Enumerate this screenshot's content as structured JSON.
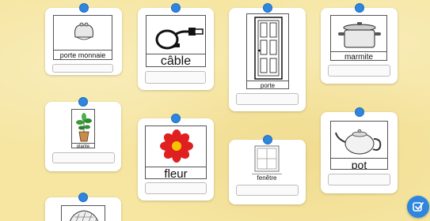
{
  "cards": [
    {
      "id": "porte-monnaie",
      "word": "porte monnaie",
      "icon": "purse-icon"
    },
    {
      "id": "cable",
      "word": "câble",
      "icon": "cable-icon"
    },
    {
      "id": "porte",
      "word": "porte",
      "icon": "door-icon"
    },
    {
      "id": "marmite",
      "word": "marmite",
      "icon": "pot-icon"
    },
    {
      "id": "plante",
      "word": "plante",
      "icon": "plant-icon"
    },
    {
      "id": "fleur",
      "word": "fleur",
      "icon": "flower-icon"
    },
    {
      "id": "fenetre",
      "word": "fenêtre",
      "icon": "window-icon"
    },
    {
      "id": "pot",
      "word": "pot",
      "icon": "teapot-icon"
    },
    {
      "id": "partial",
      "word": "",
      "icon": "pattern-icon"
    }
  ],
  "colors": {
    "background": "#f6e6a2",
    "pin": "#2e86de",
    "accent": "#2e86de",
    "flower_red": "#e02020",
    "flower_center": "#f5c400"
  },
  "check_button": {
    "icon": "check-icon"
  }
}
